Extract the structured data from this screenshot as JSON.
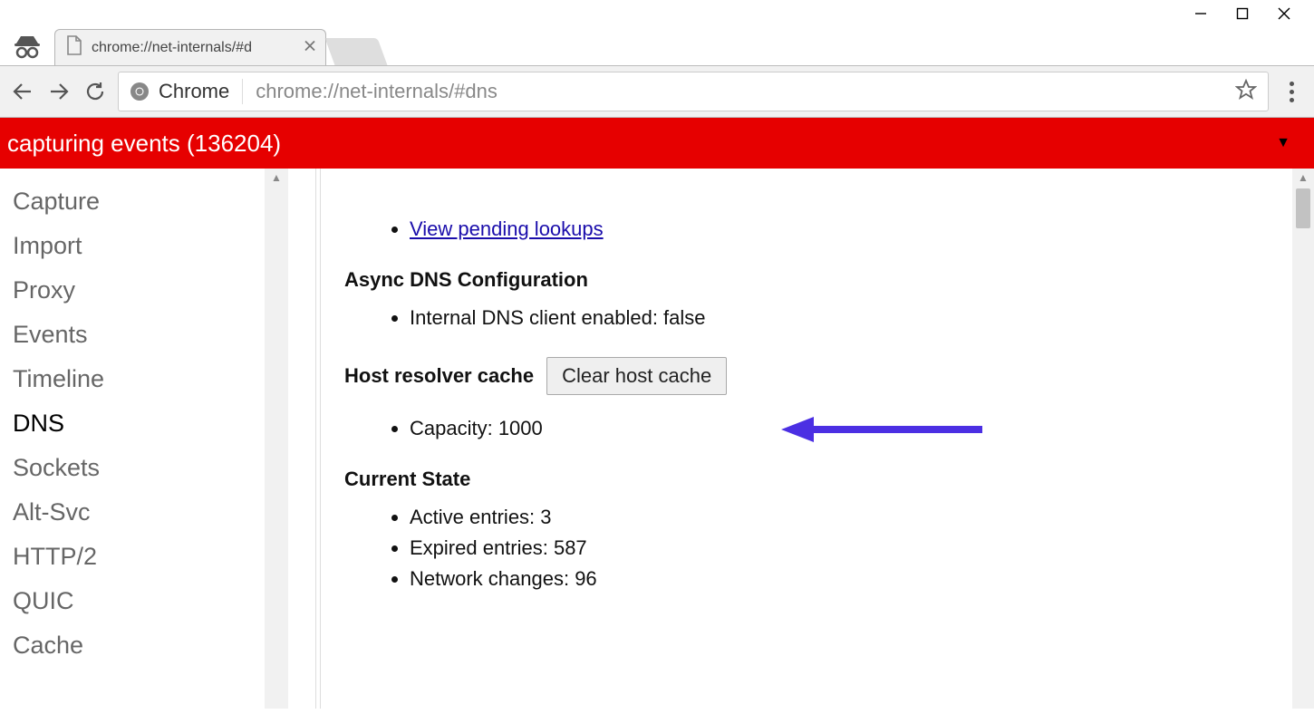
{
  "window": {
    "min": "",
    "max": "",
    "close": ""
  },
  "tab": {
    "title": "chrome://net-internals/#d"
  },
  "toolbar": {
    "chip": "Chrome",
    "url": "chrome://net-internals/#dns"
  },
  "capture_bar": {
    "text": "capturing events (136204)"
  },
  "sidebar": {
    "items": [
      {
        "label": "Capture"
      },
      {
        "label": "Import"
      },
      {
        "label": "Proxy"
      },
      {
        "label": "Events"
      },
      {
        "label": "Timeline"
      },
      {
        "label": "DNS"
      },
      {
        "label": "Sockets"
      },
      {
        "label": "Alt-Svc"
      },
      {
        "label": "HTTP/2"
      },
      {
        "label": "QUIC"
      },
      {
        "label": "Cache"
      }
    ]
  },
  "main": {
    "pending_link": "View pending lookups",
    "async_title": "Async DNS Configuration",
    "async_item": "Internal DNS client enabled: false",
    "host_resolver_label": "Host resolver cache",
    "clear_btn": "Clear host cache",
    "capacity": "Capacity: 1000",
    "current_state_title": "Current State",
    "active": "Active entries: 3",
    "expired": "Expired entries: 587",
    "netchanges": "Network changes: 96"
  }
}
